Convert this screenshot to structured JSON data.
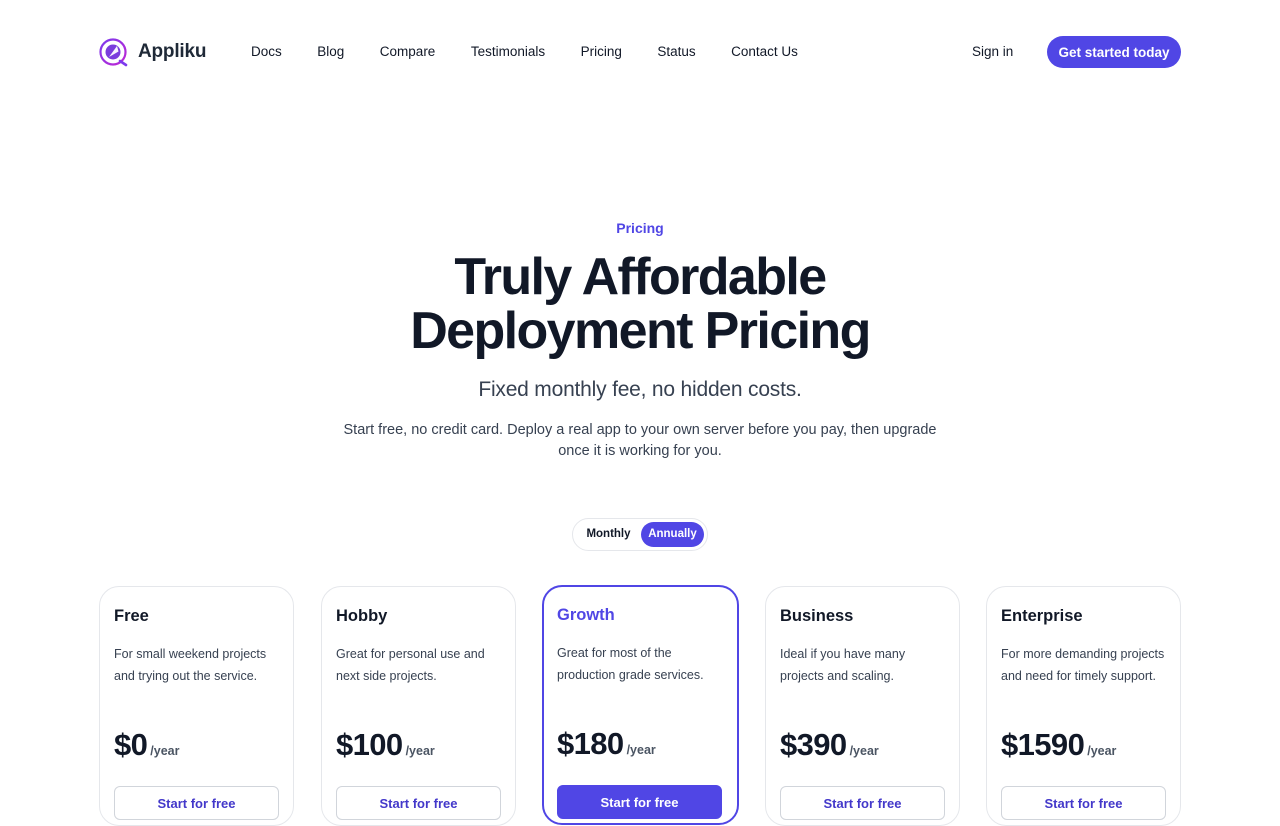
{
  "header": {
    "brand": "Appliku",
    "logo_icon": "appliku-rocket-logo-icon",
    "nav": [
      {
        "label": "Docs"
      },
      {
        "label": "Blog"
      },
      {
        "label": "Compare"
      },
      {
        "label": "Testimonials"
      },
      {
        "label": "Pricing"
      },
      {
        "label": "Status"
      },
      {
        "label": "Contact Us"
      }
    ],
    "sign_in": "Sign in",
    "cta": "Get started today"
  },
  "hero": {
    "eyebrow": "Pricing",
    "headline_line1": "Truly Affordable",
    "headline_line2": "Deployment Pricing",
    "subheadline": "Fixed monthly fee, no hidden costs.",
    "lede": "Start free, no credit card. Deploy a real app to your own server before you pay, then upgrade once it is working for you."
  },
  "billing_toggle": {
    "monthly": "Monthly",
    "annually": "Annually",
    "selected": "Annually"
  },
  "plans": [
    {
      "name": "Free",
      "description": "For small weekend projects and trying out the service.",
      "price": "$0",
      "period": "/year",
      "button": "Start for free",
      "featured": false
    },
    {
      "name": "Hobby",
      "description": "Great for personal use and next side projects.",
      "price": "$100",
      "period": "/year",
      "button": "Start for free",
      "featured": false
    },
    {
      "name": "Growth",
      "description": "Great for most of the production grade services.",
      "price": "$180",
      "period": "/year",
      "button": "Start for free",
      "featured": true
    },
    {
      "name": "Business",
      "description": "Ideal if you have many projects and scaling.",
      "price": "$390",
      "period": "/year",
      "button": "Start for free",
      "featured": false
    },
    {
      "name": "Enterprise",
      "description": "For more demanding projects and need for timely support.",
      "price": "$1590",
      "period": "/year",
      "button": "Start for free",
      "featured": false
    }
  ],
  "colors": {
    "accent": "#5046e5",
    "text": "#111827",
    "muted": "#374151",
    "border": "#e5e7eb"
  }
}
